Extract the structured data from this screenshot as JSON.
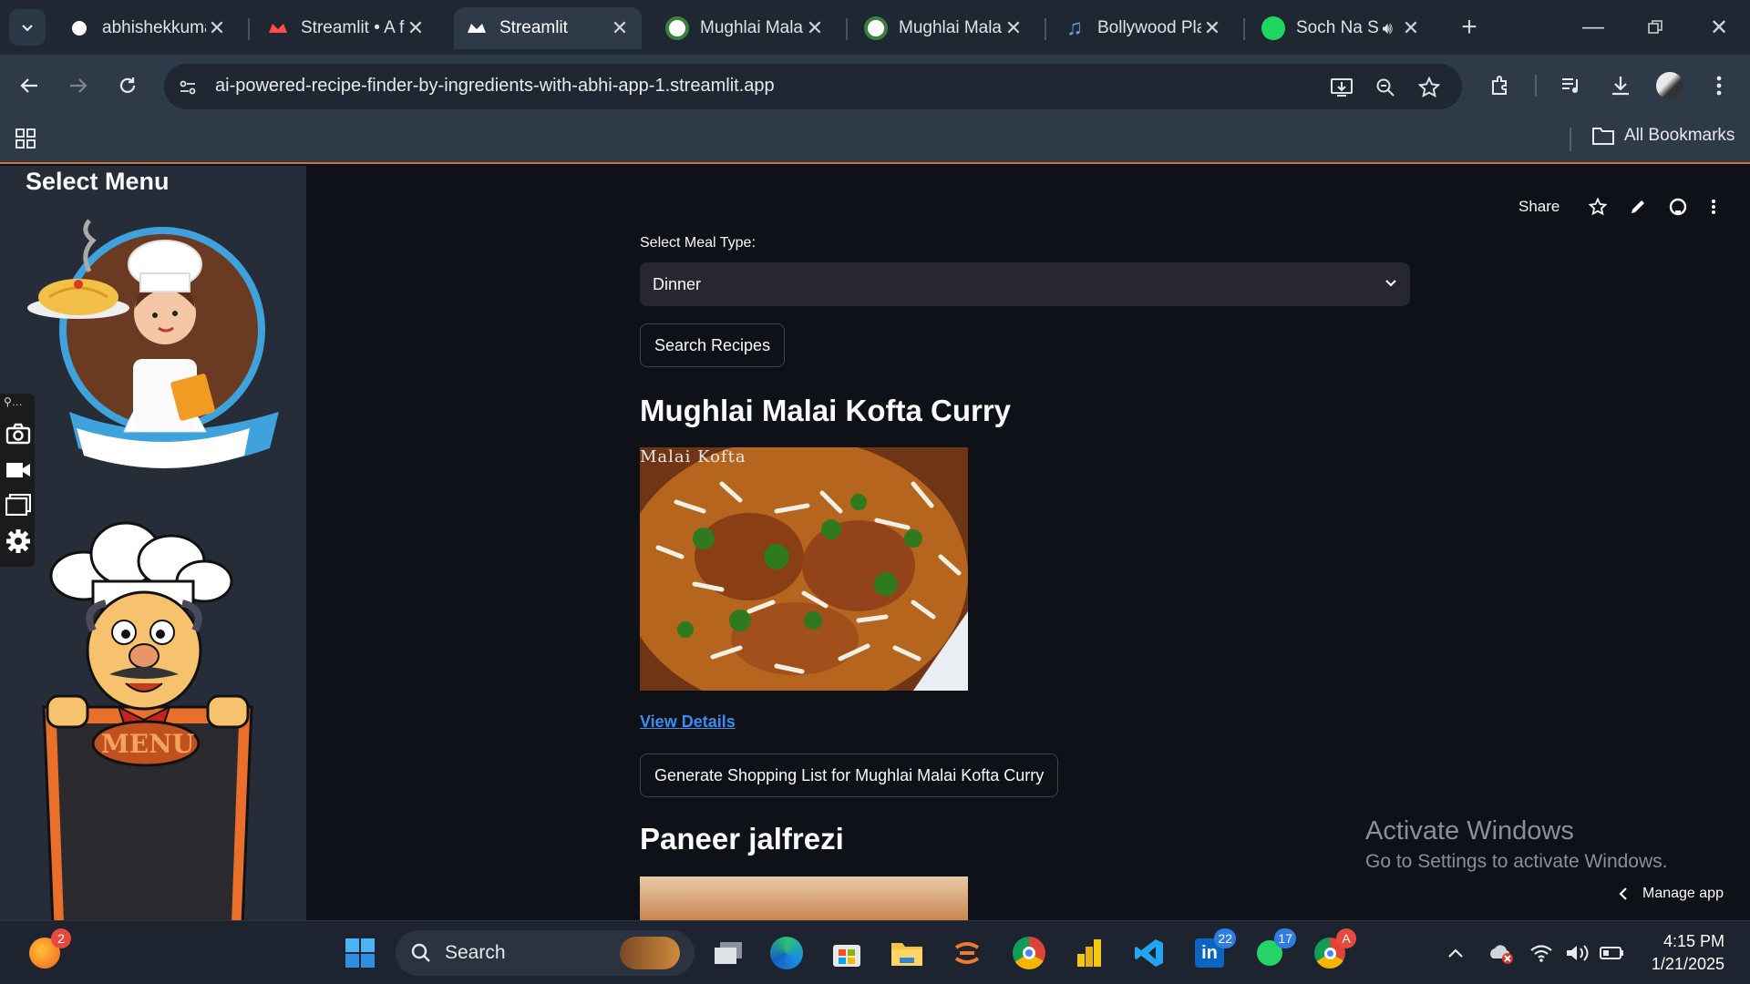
{
  "browser": {
    "tabs": [
      {
        "title": "abhishekkuma",
        "icon": "github-icon"
      },
      {
        "title": "Streamlit • A f",
        "icon": "streamlit-icon"
      },
      {
        "title": "Streamlit",
        "icon": "streamlit-icon",
        "active": true
      },
      {
        "title": "Mughlai Malai",
        "icon": "page-icon"
      },
      {
        "title": "Mughlai Malai",
        "icon": "page-icon"
      },
      {
        "title": "Bollywood Pla",
        "icon": "music-icon"
      },
      {
        "title": "Soch Na S",
        "icon": "spotify-icon"
      }
    ],
    "url": "ai-powered-recipe-finder-by-ingredients-with-abhi-app-1.streamlit.app",
    "bookmarks_label": "All Bookmarks"
  },
  "sidebar": {
    "title": "Select Menu",
    "menu_sign": "MENU"
  },
  "header": {
    "share_label": "Share"
  },
  "main": {
    "meal_type_label": "Select Meal Type:",
    "meal_type_value": "Dinner",
    "search_button": "Search Recipes",
    "recipes": [
      {
        "title": "Mughlai Malai Kofta Curry",
        "image_caption": "Malai Kofta",
        "view_details": "View Details",
        "shopping_button": "Generate Shopping List for Mughlai Malai Kofta Curry"
      },
      {
        "title": "Paneer jalfrezi"
      }
    ]
  },
  "overlay": {
    "activate_title": "Activate Windows",
    "activate_sub": "Go to Settings to activate Windows.",
    "manage_app": "Manage app"
  },
  "taskbar": {
    "search_placeholder": "Search",
    "time": "4:15 PM",
    "date": "1/21/2025",
    "badges": {
      "widgets": "2",
      "linkedin": "22",
      "whatsapp": "17",
      "chrome2": "A"
    }
  },
  "colors": {
    "accent_link": "#3b8cf0",
    "app_bg": "#0e1117",
    "sidebar_bg": "#262c38"
  }
}
